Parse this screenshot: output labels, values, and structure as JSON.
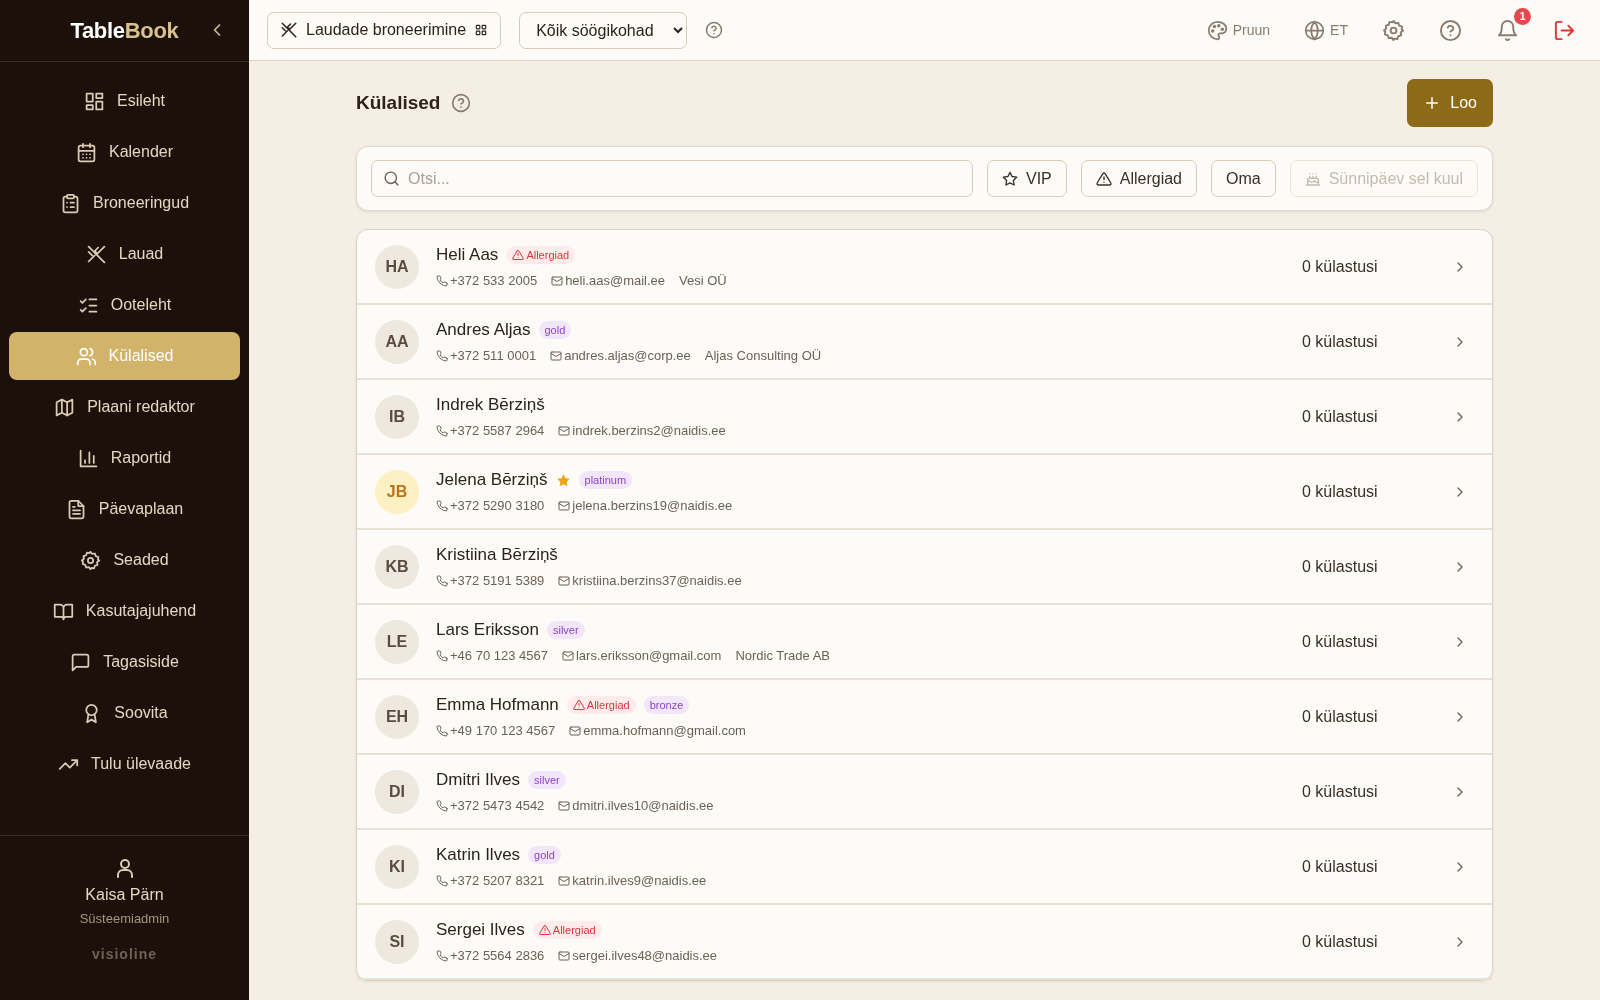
{
  "brand": {
    "first": "Table",
    "second": "Book"
  },
  "sidebar": {
    "items": [
      {
        "label": "Esileht",
        "selected": false
      },
      {
        "label": "Kalender",
        "selected": false
      },
      {
        "label": "Broneeringud",
        "selected": false
      },
      {
        "label": "Lauad",
        "selected": false
      },
      {
        "label": "Ooteleht",
        "selected": false
      },
      {
        "label": "Külalised",
        "selected": true
      },
      {
        "label": "Plaani redaktor",
        "selected": false
      },
      {
        "label": "Raportid",
        "selected": false
      },
      {
        "label": "Päevaplaan",
        "selected": false
      },
      {
        "label": "Seaded",
        "selected": false
      },
      {
        "label": "Kasutajajuhend",
        "selected": false
      },
      {
        "label": "Tagasiside",
        "selected": false
      },
      {
        "label": "Soovita",
        "selected": false
      },
      {
        "label": "Tulu ülevaade",
        "selected": false
      }
    ],
    "user": {
      "name": "Kaisa Pärn",
      "role": "Süsteemiadmin"
    },
    "footer": "visioline"
  },
  "topbar": {
    "module_button": "Laudade broneerimine",
    "venue_select": "Kõik söögikohad",
    "theme": "Pruun",
    "language": "ET",
    "notification_count": "1"
  },
  "page": {
    "title": "Külalised",
    "create_button": "Loo"
  },
  "filters": {
    "placeholder": "Otsi...",
    "chips": [
      {
        "label": "VIP",
        "disabled": false
      },
      {
        "label": "Allergiad",
        "disabled": false
      },
      {
        "label": "Oma",
        "disabled": false
      },
      {
        "label": "Sünnipäev sel kuul",
        "disabled": true
      }
    ]
  },
  "guests": [
    {
      "initials": "HA",
      "name": "Heli Aas",
      "vip": false,
      "tags": [
        {
          "kind": "allergy",
          "label": "Allergiad"
        }
      ],
      "phone": "+372 533 2005",
      "email": "heli.aas@mail.ee",
      "company": "Vesi OÜ",
      "visits": "0 külastusi"
    },
    {
      "initials": "AA",
      "name": "Andres Aljas",
      "vip": false,
      "tags": [
        {
          "kind": "tier",
          "label": "gold"
        }
      ],
      "phone": "+372 511 0001",
      "email": "andres.aljas@corp.ee",
      "company": "Aljas Consulting OÜ",
      "visits": "0 külastusi"
    },
    {
      "initials": "IB",
      "name": "Indrek Bērziņš",
      "vip": false,
      "phone": "+372 5587 2964",
      "email": "indrek.berzins2@naidis.ee",
      "visits": "0 külastusi"
    },
    {
      "initials": "JB",
      "name": "Jelena Bērziņš",
      "vip": true,
      "tags": [
        {
          "kind": "tier",
          "label": "platinum"
        }
      ],
      "phone": "+372 5290 3180",
      "email": "jelena.berzins19@naidis.ee",
      "visits": "0 külastusi"
    },
    {
      "initials": "KB",
      "name": "Kristiina Bērziņš",
      "vip": false,
      "phone": "+372 5191 5389",
      "email": "kristiina.berzins37@naidis.ee",
      "visits": "0 külastusi"
    },
    {
      "initials": "LE",
      "name": "Lars Eriksson",
      "vip": false,
      "tags": [
        {
          "kind": "tier",
          "label": "silver"
        }
      ],
      "phone": "+46 70 123 4567",
      "email": "lars.eriksson@gmail.com",
      "company": "Nordic Trade AB",
      "visits": "0 külastusi"
    },
    {
      "initials": "EH",
      "name": "Emma Hofmann",
      "vip": false,
      "tags": [
        {
          "kind": "allergy",
          "label": "Allergiad"
        },
        {
          "kind": "tier",
          "label": "bronze"
        }
      ],
      "phone": "+49 170 123 4567",
      "email": "emma.hofmann@gmail.com",
      "visits": "0 külastusi"
    },
    {
      "initials": "DI",
      "name": "Dmitri Ilves",
      "vip": false,
      "tags": [
        {
          "kind": "tier",
          "label": "silver"
        }
      ],
      "phone": "+372 5473 4542",
      "email": "dmitri.ilves10@naidis.ee",
      "visits": "0 külastusi"
    },
    {
      "initials": "KI",
      "name": "Katrin Ilves",
      "vip": false,
      "tags": [
        {
          "kind": "tier",
          "label": "gold"
        }
      ],
      "phone": "+372 5207 8321",
      "email": "katrin.ilves9@naidis.ee",
      "visits": "0 külastusi"
    },
    {
      "initials": "SI",
      "name": "Sergei Ilves",
      "vip": false,
      "tags": [
        {
          "kind": "allergy",
          "label": "Allergiad"
        }
      ],
      "phone": "+372 5564 2836",
      "email": "sergei.ilves48@naidis.ee",
      "visits": "0 külastusi"
    }
  ]
}
